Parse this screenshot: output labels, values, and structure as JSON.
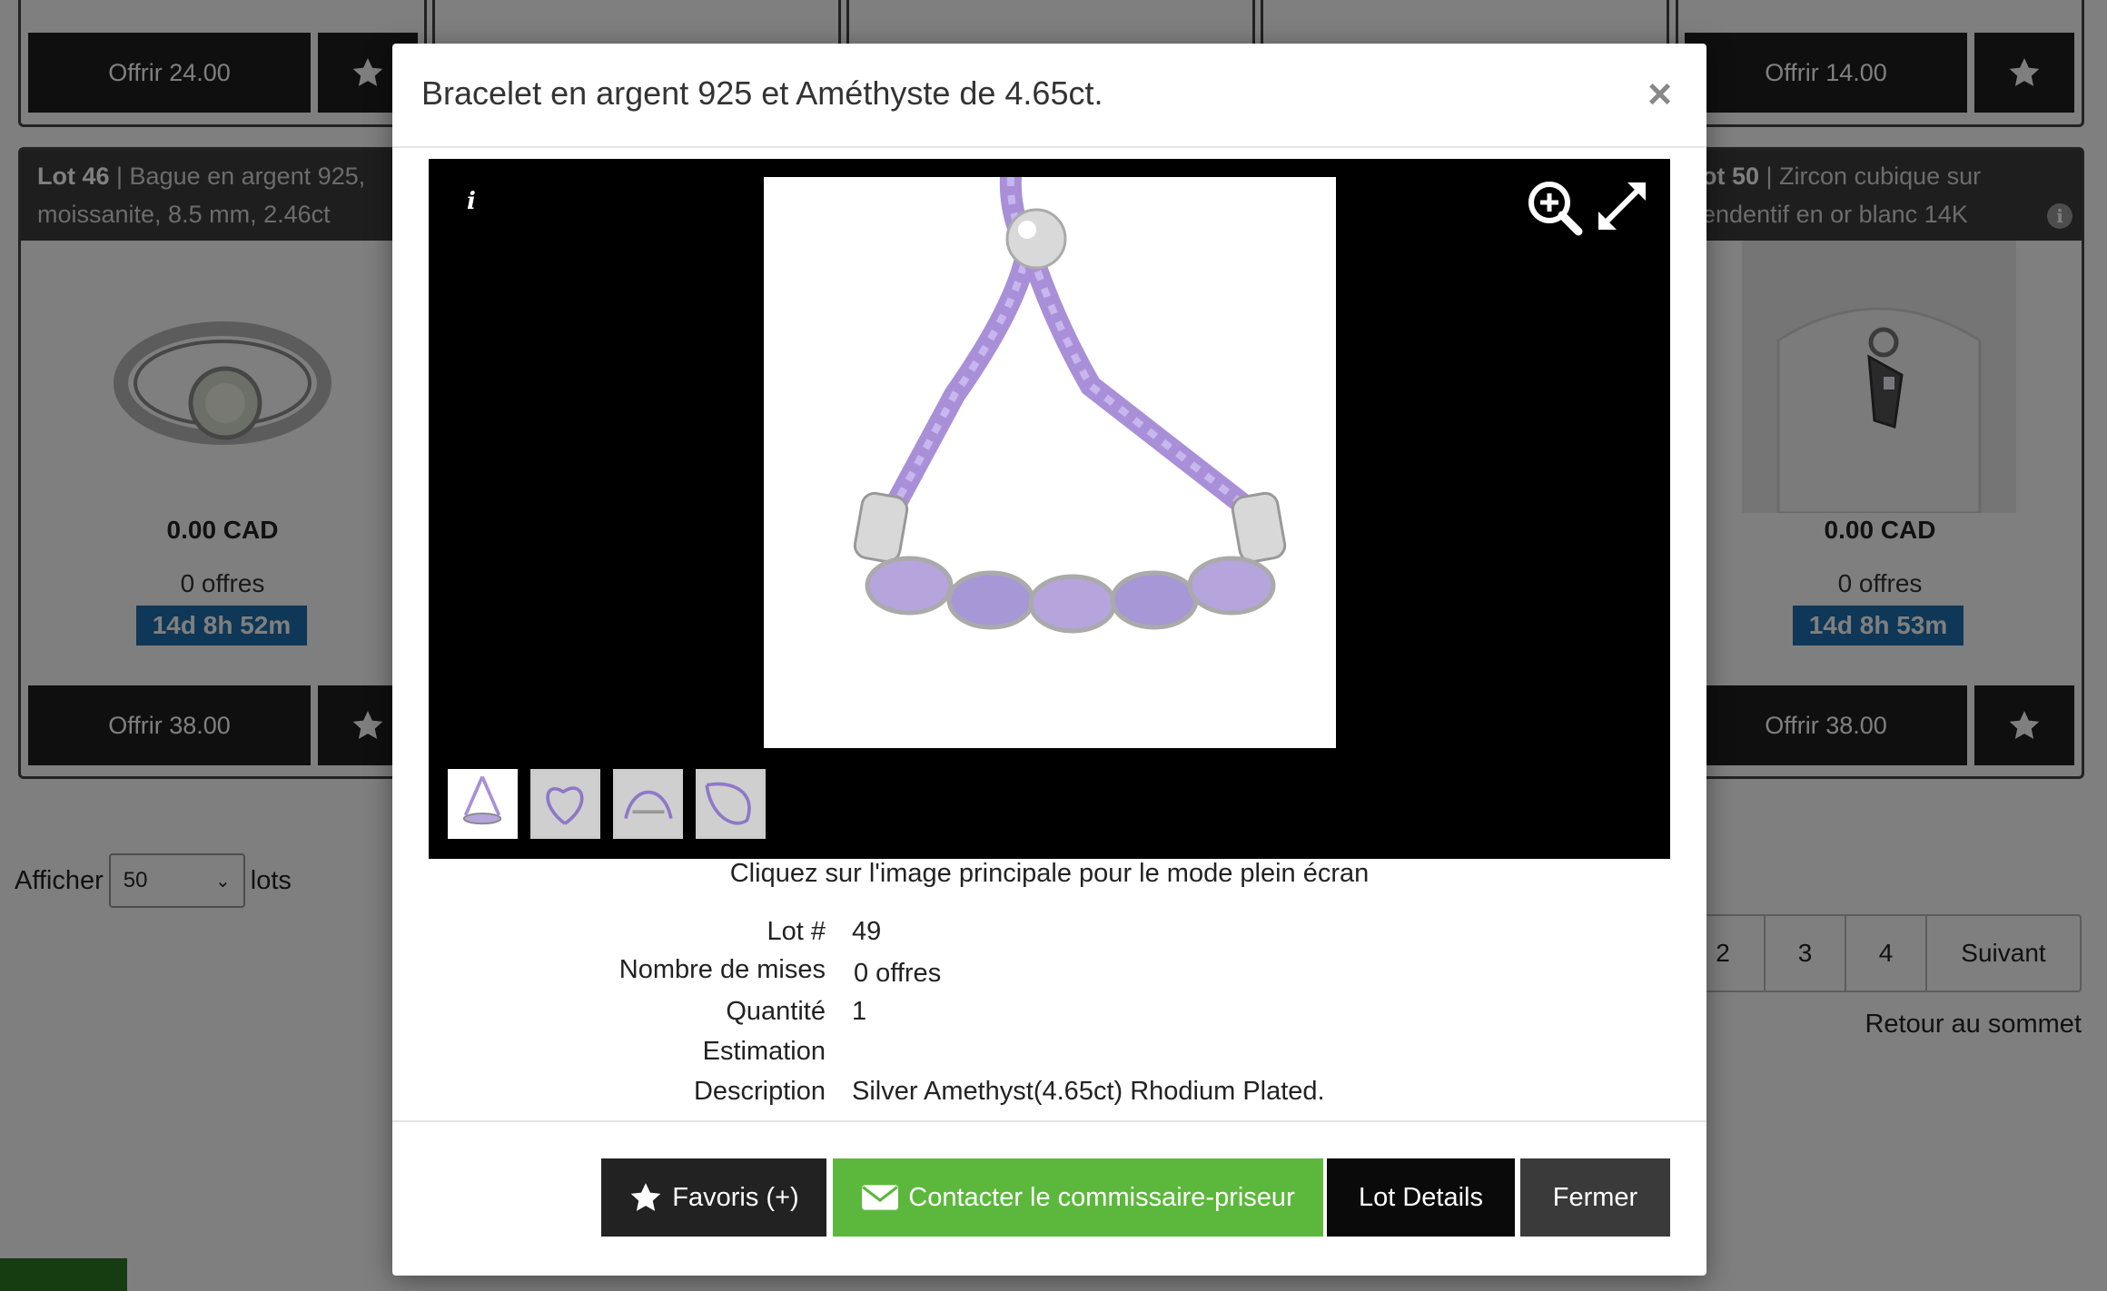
{
  "background": {
    "top_row_offers": [
      {
        "label": "Offrir 24.00"
      },
      {
        "label": "Offrir 14.00"
      }
    ],
    "cards": [
      {
        "lot": "Lot 46",
        "title": "| Bague en argent 925, moissanite, 8.5 mm, 2.46ct",
        "price": "0.00 CAD",
        "offers": "0 offres",
        "timer": "14d 8h 52m",
        "offer_label": "Offrir 38.00"
      },
      {
        "lot": "ot 50",
        "title": "| Zircon cubique sur endentif en or blanc 14K",
        "price": "0.00 CAD",
        "offers": "0 offres",
        "timer": "14d 8h 53m",
        "offer_label": "Offrir 38.00"
      }
    ],
    "afficher": {
      "prefix": "Afficher",
      "value": "50",
      "suffix": "lots"
    },
    "pagination": [
      "2",
      "3",
      "4",
      "Suivant"
    ],
    "back_to_top": "Retour au sommet"
  },
  "modal": {
    "title": "Bracelet en argent 925 et Améthyste de 4.65ct.",
    "close_icon": "×",
    "caption": "Cliquez sur l'image principale pour le mode plein écran",
    "details": [
      {
        "label": "Lot #",
        "value": "49"
      },
      {
        "label": "Nombre de mises",
        "value": "0 offres"
      },
      {
        "label": "Quantité",
        "value": "1"
      },
      {
        "label": "Estimation",
        "value": ""
      },
      {
        "label": "Description",
        "value": "Silver Amethyst(4.65ct) Rhodium Plated."
      }
    ],
    "buttons": {
      "favorites": "Favoris (+)",
      "contact": "Contacter le commissaire-priseur",
      "details": "Lot Details",
      "close": "Fermer"
    },
    "colors": {
      "contact_green": "#5cb83c",
      "timer_blue": "#1e6fae",
      "cord_lavender": "#a98fd8"
    }
  }
}
